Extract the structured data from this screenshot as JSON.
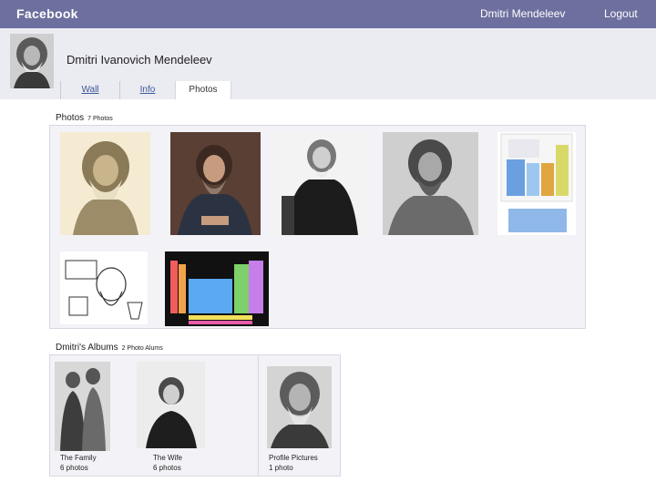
{
  "topbar": {
    "brand": "Facebook",
    "user_name": "Dmitri Mendeleev",
    "logout": "Logout",
    "bar_color": "#6d6f9e"
  },
  "profile": {
    "name": "Dmitri Ivanovich Mendeleev",
    "tabs": [
      {
        "label": "Wall",
        "active": false
      },
      {
        "label": "Info",
        "active": false
      },
      {
        "label": "Photos",
        "active": true
      }
    ]
  },
  "photos": {
    "title": "Photos",
    "count": "7 Photos"
  },
  "albums": {
    "title": "Dmitri's Albums",
    "count": "2 Photo Alums",
    "items": [
      {
        "name": "The Family",
        "count": "6 photos"
      },
      {
        "name": "The Wife",
        "count": "6 photos"
      },
      {
        "name": "Profile Pictures",
        "count": "1 photo"
      }
    ]
  },
  "colors": {
    "link": "#3b5998",
    "band": "#ebebf2",
    "panel": "#f2f2f7"
  }
}
